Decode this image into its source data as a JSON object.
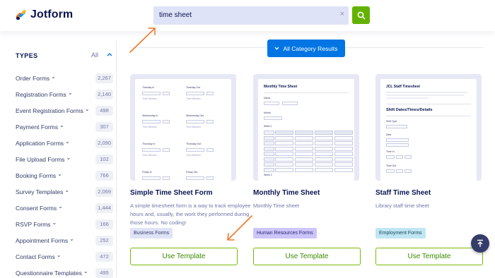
{
  "brand": {
    "name": "Jotform"
  },
  "search": {
    "query": "time sheet",
    "clear_icon": "×"
  },
  "sidebar": {
    "title": "TYPES",
    "all_label": "All",
    "items": [
      {
        "label": "Order Forms",
        "count": "2,267"
      },
      {
        "label": "Registration Forms",
        "count": "2,140"
      },
      {
        "label": "Event Registration Forms",
        "count": "498"
      },
      {
        "label": "Payment Forms",
        "count": "307"
      },
      {
        "label": "Application Forms",
        "count": "2,090"
      },
      {
        "label": "File Upload Forms",
        "count": "102"
      },
      {
        "label": "Booking Forms",
        "count": "766"
      },
      {
        "label": "Survey Templates",
        "count": "2,069"
      },
      {
        "label": "Consent Forms",
        "count": "1,444"
      },
      {
        "label": "RSVP Forms",
        "count": "166"
      },
      {
        "label": "Appointment Forms",
        "count": "252"
      },
      {
        "label": "Contact Forms",
        "count": "472"
      },
      {
        "label": "Questionnaire Templates",
        "count": "495"
      }
    ]
  },
  "results_button": {
    "label": "All Category Results"
  },
  "cards": [
    {
      "title": "Simple Time Sheet Form",
      "description": "A simple timesheet form is a way to track employee hours and, usually, the work they performed during those hours. No coding!",
      "category": "Business Forms",
      "category_color": "#dfe3f7",
      "button": "Use Template",
      "preview": {
        "rows": [
          {
            "left": "Tuesday In",
            "right": "Tuesday Out"
          },
          {
            "left": "Wednesday In",
            "right": "Wednesday Out"
          },
          {
            "left": "Thursday In",
            "right": "Thursday Out"
          },
          {
            "left": "Friday In",
            "right": "Friday Out"
          }
        ],
        "sub": "Time Minutes"
      }
    },
    {
      "title": "Monthly Time Sheet",
      "description": "Monthly Time sheet",
      "category": "Human Resources Forms",
      "category_color": "#cbc5f9",
      "button": "Use Template",
      "preview": {
        "heading": "Monthly Time Sheet",
        "name": "Name",
        "month": "Month",
        "week": "Week 1",
        "week2": "Week 2"
      }
    },
    {
      "title": "Staff Time Sheet",
      "description": "Library staff time sheet",
      "category": "Employment Forms",
      "category_color": "#bfe6f2",
      "button": "Use Template",
      "preview": {
        "heading": "JCL Staff Timesheet",
        "section": "Shift Dates/Times/Details",
        "shift_type": "Shift Type",
        "date": "Date",
        "time_in": "Time In",
        "time_out": "Time Out"
      }
    }
  ],
  "colors": {
    "accent_green": "#64b200",
    "accent_blue": "#0075e3",
    "brand_navy": "#0a1551",
    "annotation_arrow": "#f07a2a"
  }
}
